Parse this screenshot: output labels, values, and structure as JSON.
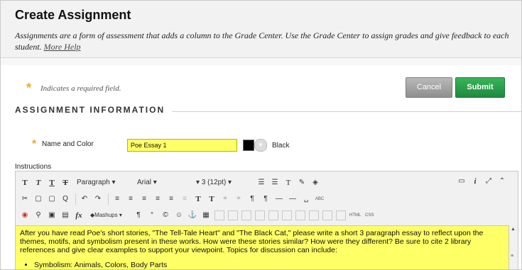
{
  "page": {
    "title": "Create Assignment",
    "description": "Assignments are a form of assessment that adds a column to the Grade Center. Use the Grade Center to assign grades and give feedback to each student.",
    "help_link": "More Help"
  },
  "required_note": "Indicates a required field.",
  "buttons": {
    "cancel": "Cancel",
    "submit": "Submit"
  },
  "section_title": "ASSIGNMENT INFORMATION",
  "name_field": {
    "label": "Name and Color",
    "value": "Poe Essay 1",
    "color_name": "Black",
    "color_hex": "#000000"
  },
  "instructions": {
    "label": "Instructions",
    "toolbar": {
      "row1": [
        "T",
        "T",
        "T",
        "T",
        "Paragraph",
        "Arial",
        "3 (12pt)",
        "☰",
        "☰",
        "T",
        "✎",
        "◈"
      ],
      "row2": [
        "✂",
        "▢",
        "▢",
        "Q",
        "↶",
        "↷",
        "≡",
        "≡",
        "≡",
        "≡",
        "≡",
        "≡",
        "T",
        "T",
        "⚭",
        "⚭",
        "¶",
        "¶",
        "—",
        "—",
        "␣",
        "ABC"
      ],
      "row3": [
        "◉",
        "⚲",
        "▣",
        "▤",
        "fx",
        "Mashups",
        "¶",
        "“",
        "©",
        "☺",
        "⚓",
        "▦",
        "HTML",
        "CSS"
      ],
      "right": [
        "▭",
        "i",
        "⤢",
        "⌃"
      ]
    },
    "content": "After you have read Poe's short stories, \"The Tell-Tale Heart\" and \"The Black Cat,\" please write a short 3 paragraph essay to reflect upon the themes, motifs, and symbolism present in these works. How were these stories similar? How were they different?  Be sure to cite 2 library references and give clear examples to support your viewpoint.  Topics for discussion can include:",
    "list_item": "Symbolism: Animals, Colors, Body Parts",
    "highlight_color": "#ffff66"
  }
}
